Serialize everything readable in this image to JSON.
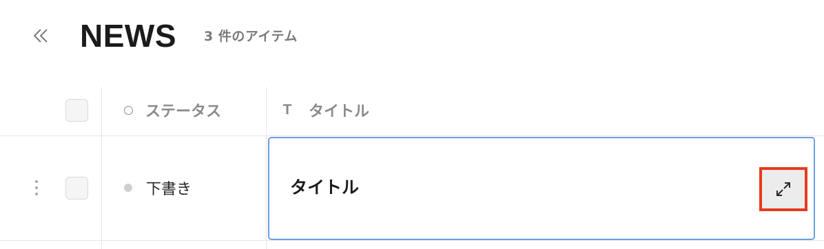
{
  "header": {
    "title": "NEWS",
    "item_count": "3 件のアイテム",
    "collapse_icon": "double-chevron-left-icon"
  },
  "table": {
    "columns": [
      {
        "icon": "circle-icon",
        "label": "ステータス"
      },
      {
        "icon": "text-type-icon",
        "label": "タイトル"
      }
    ],
    "rows": [
      {
        "status": "下書き",
        "title": "タイトル"
      }
    ],
    "colors": {
      "selection_border": "#6b9ee6",
      "highlight_border": "#e53a1f",
      "status_dot": "#cfcfcf"
    }
  }
}
